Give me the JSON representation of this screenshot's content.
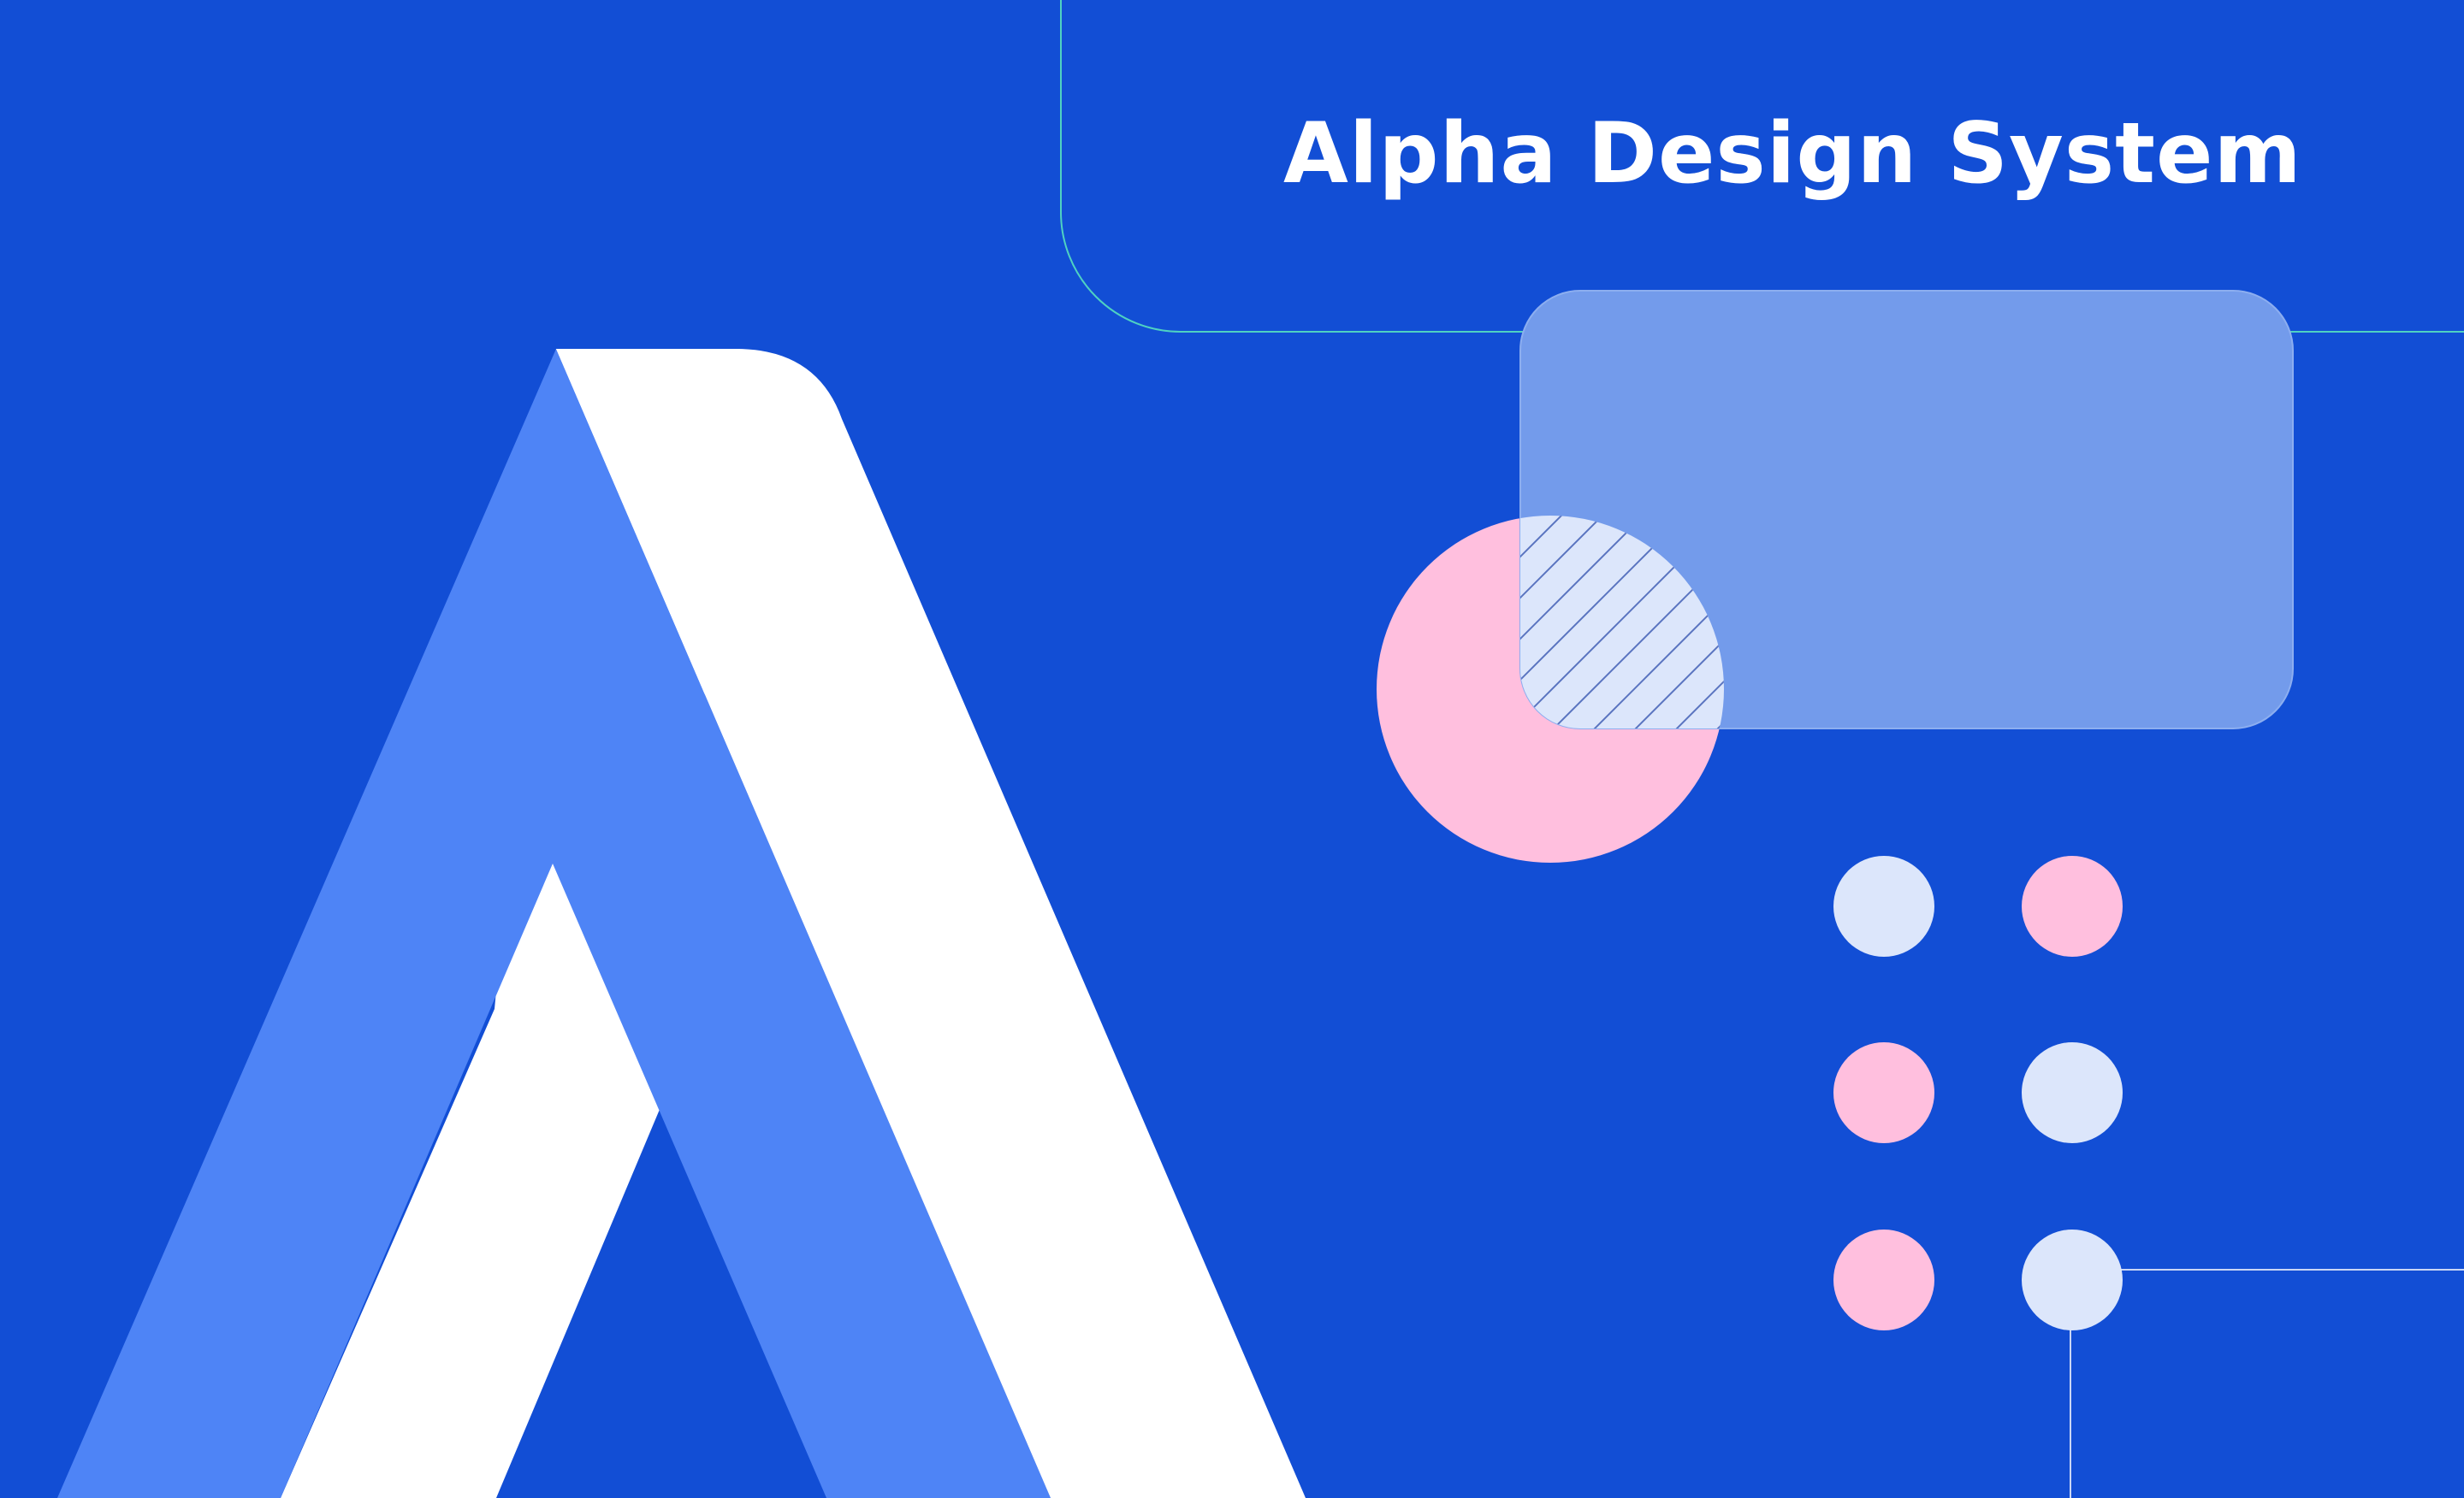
{
  "banner": {
    "title": "Alpha Design System"
  },
  "colors": {
    "background": "#124ED5",
    "logo_light": "#FFFFFF",
    "logo_mid": "#4E84F6",
    "card": "#739BEB",
    "pink": "#FFBFDE",
    "pale_blue": "#DCE6FB",
    "outline_teal": "#4FD2C2",
    "hatch_line": "#5A74C0"
  },
  "icons": {
    "logo": "alpha-a-logo-icon",
    "dot_grid": "dot-grid-icon"
  },
  "dot_grid": {
    "colors": [
      "pale_blue",
      "pink",
      "pink",
      "pale_blue",
      "pink",
      "pale_blue"
    ]
  }
}
